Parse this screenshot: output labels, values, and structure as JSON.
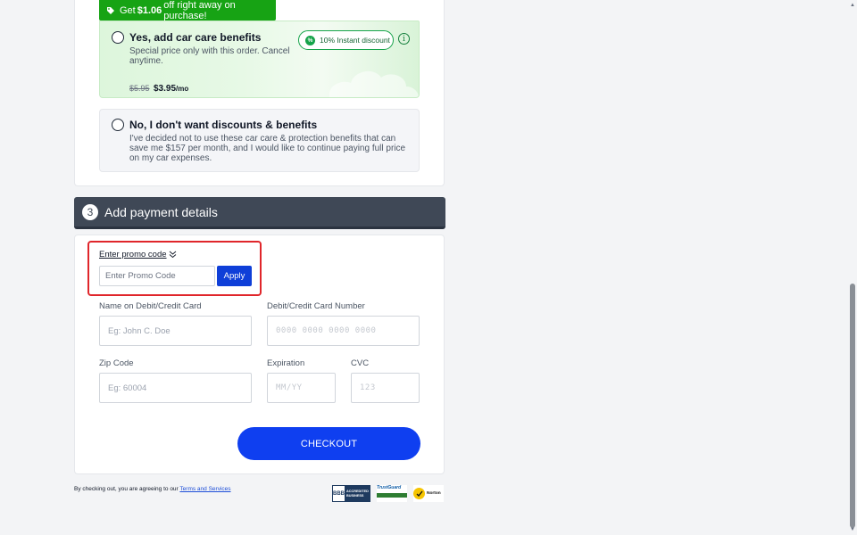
{
  "banner": {
    "prefix": "Get",
    "amount": "$1.06",
    "suffix": "off right away on purchase!"
  },
  "option_yes": {
    "title": "Yes, add car care benefits",
    "description": "Special price only with this order. Cancel anytime.",
    "old_price": "$5.95",
    "new_price": "$3.95",
    "period": "/mo",
    "discount_pill": "10% Instant discount",
    "pill_icon": "%"
  },
  "option_no": {
    "title": "No, I don't want discounts & benefits",
    "description": "I've decided not to use these car care & protection benefits that can save me $157 per month, and I would like to continue paying full price on my car expenses."
  },
  "section": {
    "step": "3",
    "title": "Add payment details"
  },
  "promo": {
    "toggle_label": "Enter promo code",
    "placeholder": "Enter Promo Code",
    "apply_label": "Apply"
  },
  "fields": {
    "name": {
      "label": "Name on Debit/Credit Card",
      "placeholder": "Eg: John C. Doe"
    },
    "card": {
      "label": "Debit/Credit Card Number",
      "placeholder": "0000 0000 0000 0000"
    },
    "zip": {
      "label": "Zip Code",
      "placeholder": "Eg: 60004"
    },
    "exp": {
      "label": "Expiration",
      "placeholder": "MM/YY"
    },
    "cvc": {
      "label": "CVC",
      "placeholder": "123"
    }
  },
  "checkout_label": "CHECKOUT",
  "terms": {
    "text": "By checking out, you are agreeing to our",
    "link": "Terms and Services"
  },
  "badges": {
    "bbb": {
      "seal": "BBB",
      "text": "ACCREDITED BUSINESS"
    },
    "trust": {
      "text": "TrustGuard"
    },
    "norton": {
      "text": "Norton"
    }
  },
  "colors": {
    "accent_blue": "#0f3ff0",
    "banner_green": "#17a314",
    "header_dark": "#3f4856",
    "highlight_red": "#e0262b"
  }
}
